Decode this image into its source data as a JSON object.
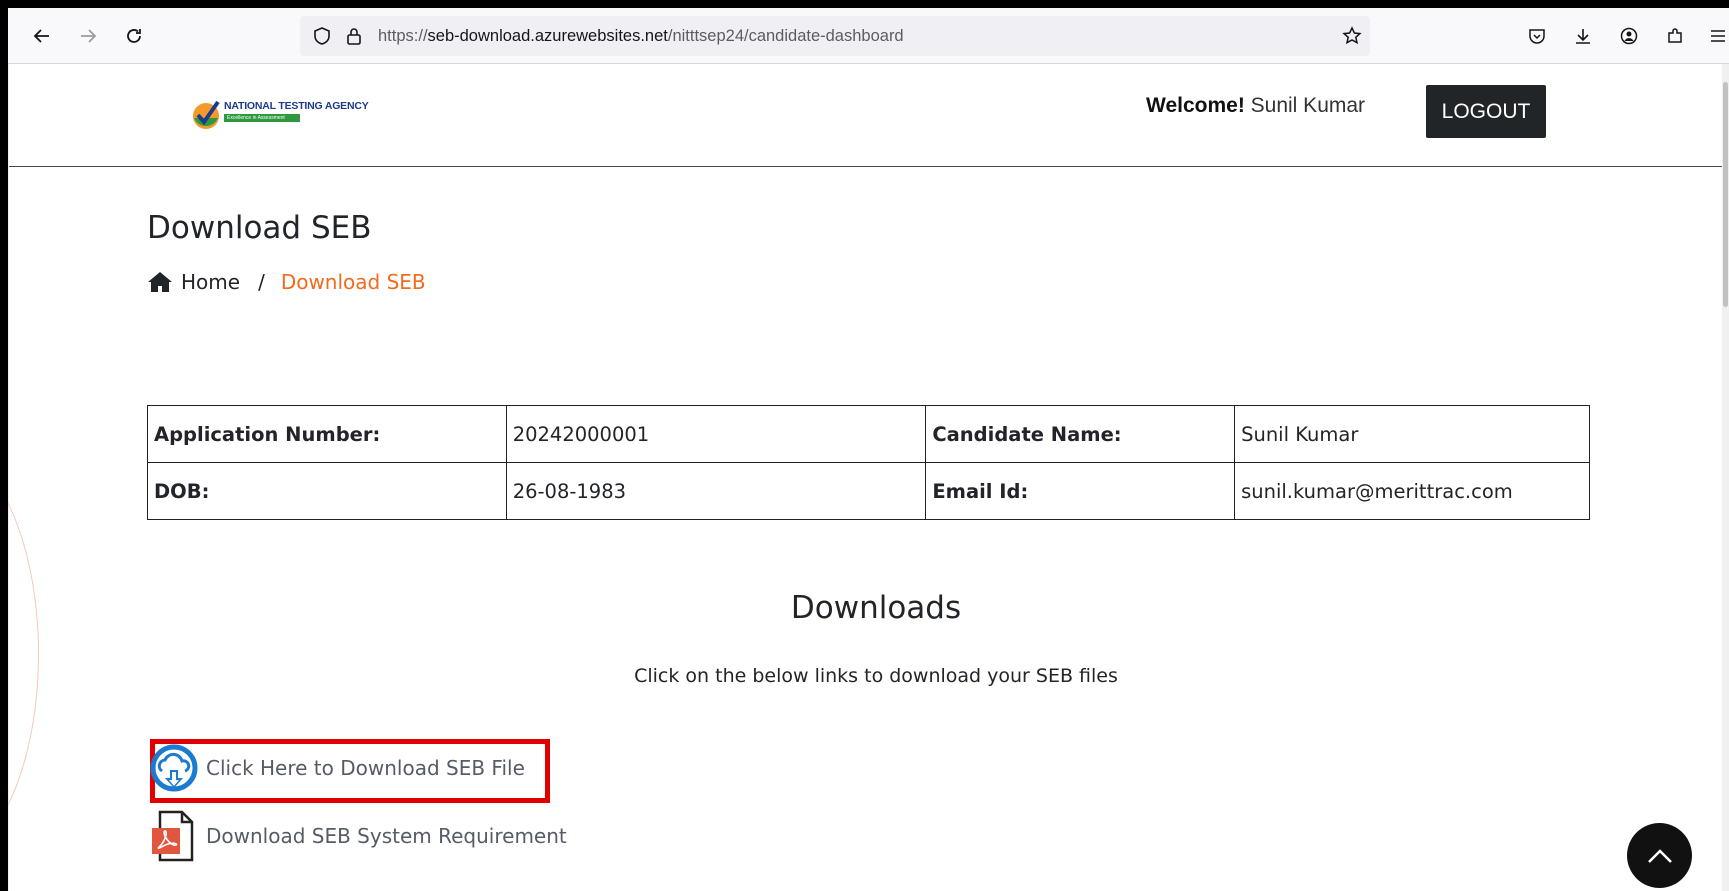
{
  "browser": {
    "url_prefix": "https://",
    "url_host": "seb-download.azurewebsites.net",
    "url_path": "/nitttsep24/candidate-dashboard"
  },
  "header": {
    "logo_text": "NATIONAL TESTING AGENCY",
    "logo_tagline": "Excellence in Assessment",
    "welcome_label": "Welcome!",
    "user_name": "Sunil Kumar",
    "logout_label": "LOGOUT"
  },
  "page": {
    "title": "Download SEB",
    "breadcrumb": {
      "home": "Home",
      "separator": "/",
      "current": "Download SEB"
    }
  },
  "candidate_table": {
    "rows": [
      {
        "label1": "Application Number:",
        "value1": "20242000001",
        "label2": "Candidate Name:",
        "value2": "Sunil Kumar"
      },
      {
        "label1": "DOB:",
        "value1": "26-08-1983",
        "label2": "Email Id:",
        "value2": "sunil.kumar@merittrac.com"
      }
    ]
  },
  "downloads": {
    "title": "Downloads",
    "subtitle": "Click on the below links to download your SEB files",
    "links": [
      {
        "label": "Click Here to Download SEB File",
        "icon": "cloud-download-icon"
      },
      {
        "label": "Download SEB System Requirement",
        "icon": "pdf-file-icon"
      }
    ]
  },
  "colors": {
    "accent": "#f26b1d",
    "dark": "#222528",
    "highlight": "#e00000",
    "download_blue": "#1a7bd0"
  }
}
